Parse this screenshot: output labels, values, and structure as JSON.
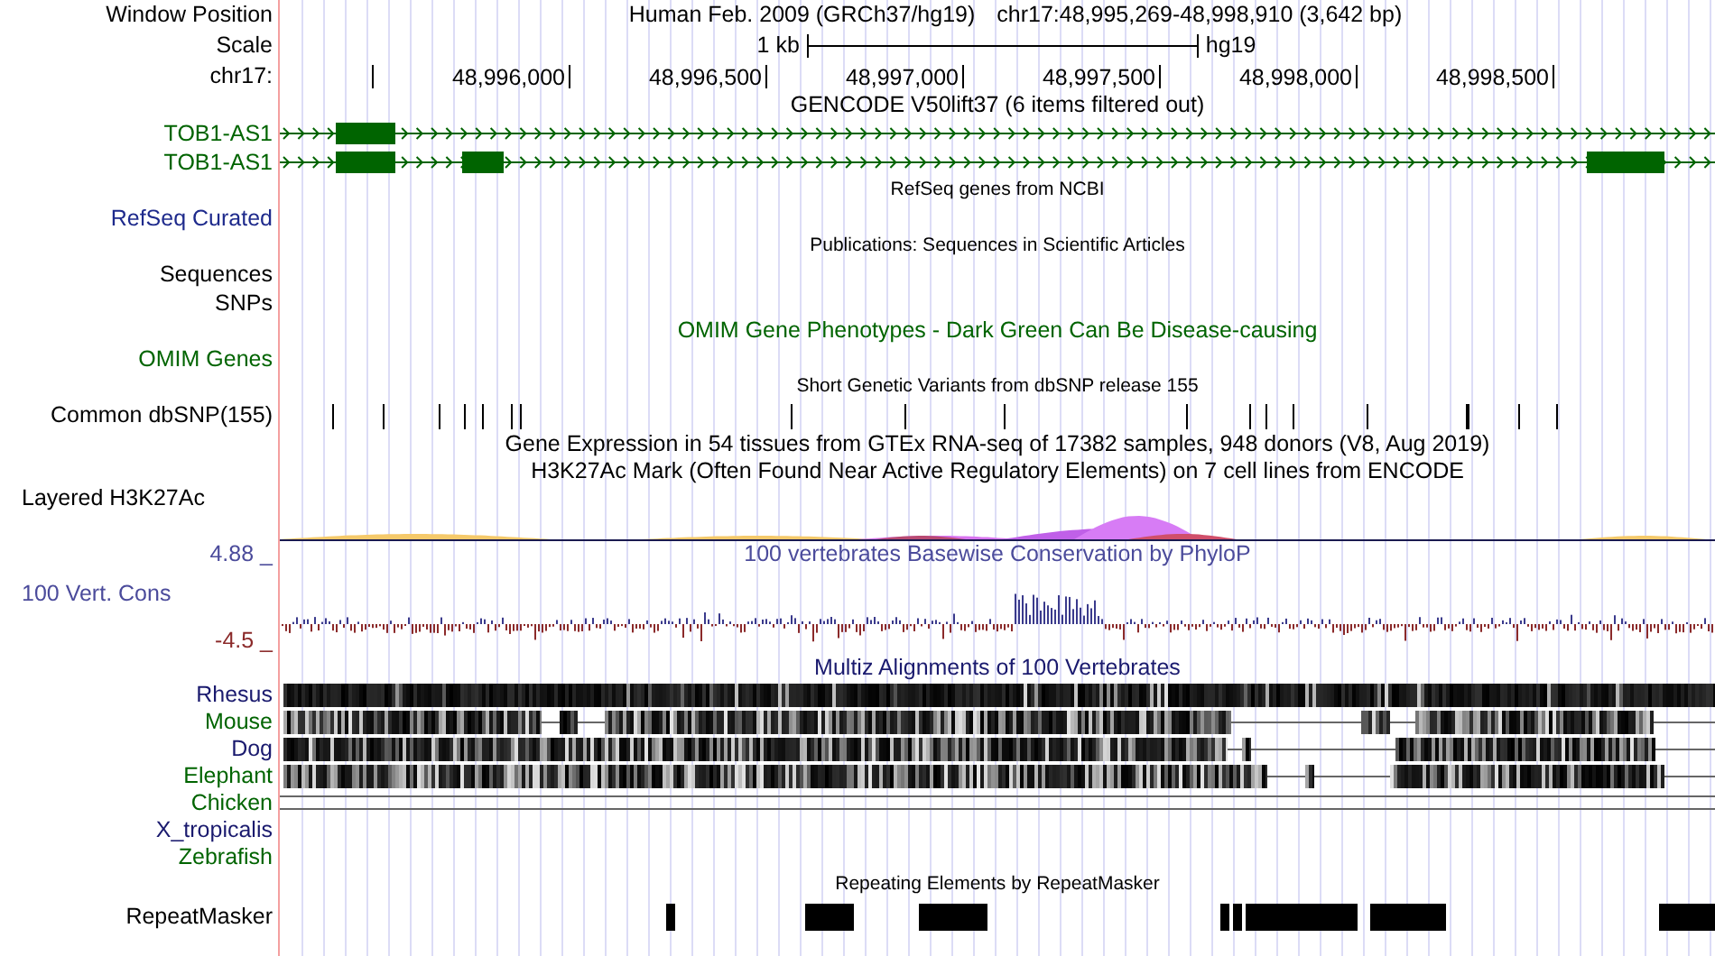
{
  "header": {
    "label": "Window Position",
    "assembly": "Human Feb. 2009 (GRCh37/hg19)",
    "position": "chr17:48,995,269-48,998,910 (3,642 bp)"
  },
  "scale": {
    "label": "Scale",
    "length": "1 kb",
    "assembly": "hg19"
  },
  "ruler": {
    "label": "chr17:",
    "ticks": [
      "48,996,000",
      "48,996,500",
      "48,997,000",
      "48,997,500",
      "48,998,000",
      "48,998,500"
    ]
  },
  "tracks": [
    {
      "kind": "title",
      "text": "GENCODE V50lift37 (6 items filtered out)",
      "small": false,
      "color": "#000000"
    },
    {
      "kind": "gene",
      "label": "TOB1-AS1",
      "color": "#006400"
    },
    {
      "kind": "gene",
      "label": "TOB1-AS1",
      "color": "#006400"
    },
    {
      "kind": "title",
      "text": "RefSeq genes from NCBI",
      "small": true,
      "color": "#000000"
    },
    {
      "kind": "label",
      "label": "RefSeq Curated",
      "color": "#1e2a8c"
    },
    {
      "kind": "title",
      "text": "Publications: Sequences in Scientific Articles",
      "small": true,
      "color": "#000000"
    },
    {
      "kind": "label",
      "label": "Sequences",
      "color": "#000000"
    },
    {
      "kind": "label",
      "label": "SNPs",
      "color": "#000000"
    },
    {
      "kind": "title",
      "text": "OMIM Gene Phenotypes - Dark Green Can Be Disease-causing",
      "small": false,
      "color": "#006400"
    },
    {
      "kind": "label",
      "label": "OMIM Genes",
      "color": "#006400"
    },
    {
      "kind": "title",
      "text": "Short Genetic Variants from dbSNP release 155",
      "small": true,
      "color": "#000000"
    },
    {
      "kind": "snps",
      "label": "Common dbSNP(155)",
      "color": "#000000"
    },
    {
      "kind": "title",
      "text": "Gene Expression in 54 tissues from GTEx RNA-seq of 17382 samples, 948 donors (V8, Aug 2019)",
      "small": false,
      "color": "#000000"
    },
    {
      "kind": "title",
      "text": "H3K27Ac Mark (Often Found Near Active Regulatory Elements) on 7 cell lines from ENCODE",
      "small": false,
      "color": "#000000"
    },
    {
      "kind": "layered",
      "label": "Layered H3K27Ac",
      "color": "#000000"
    },
    {
      "kind": "wiggle",
      "label": "100 Vert. Cons",
      "color": "#4b4b9b",
      "title": "100 vertebrates Basewise Conservation by PhyloP",
      "max": "4.88 _",
      "min": "-4.5 _"
    },
    {
      "kind": "title",
      "text": "Multiz Alignments of 100 Vertebrates",
      "small": false,
      "color": "#1a1a6e"
    },
    {
      "kind": "species",
      "label": "Rhesus",
      "color": "#1a1a6e"
    },
    {
      "kind": "species",
      "label": "Mouse",
      "color": "#006400"
    },
    {
      "kind": "species",
      "label": "Dog",
      "color": "#1a1a6e"
    },
    {
      "kind": "species",
      "label": "Elephant",
      "color": "#006400"
    },
    {
      "kind": "species",
      "label": "Chicken",
      "color": "#006400"
    },
    {
      "kind": "species",
      "label": "X_tropicalis",
      "color": "#1a1a6e"
    },
    {
      "kind": "species",
      "label": "Zebrafish",
      "color": "#006400"
    },
    {
      "kind": "title",
      "text": "Repeating Elements by RepeatMasker",
      "small": true,
      "color": "#000000"
    },
    {
      "kind": "repeats",
      "label": "RepeatMasker",
      "color": "#000000"
    }
  ]
}
